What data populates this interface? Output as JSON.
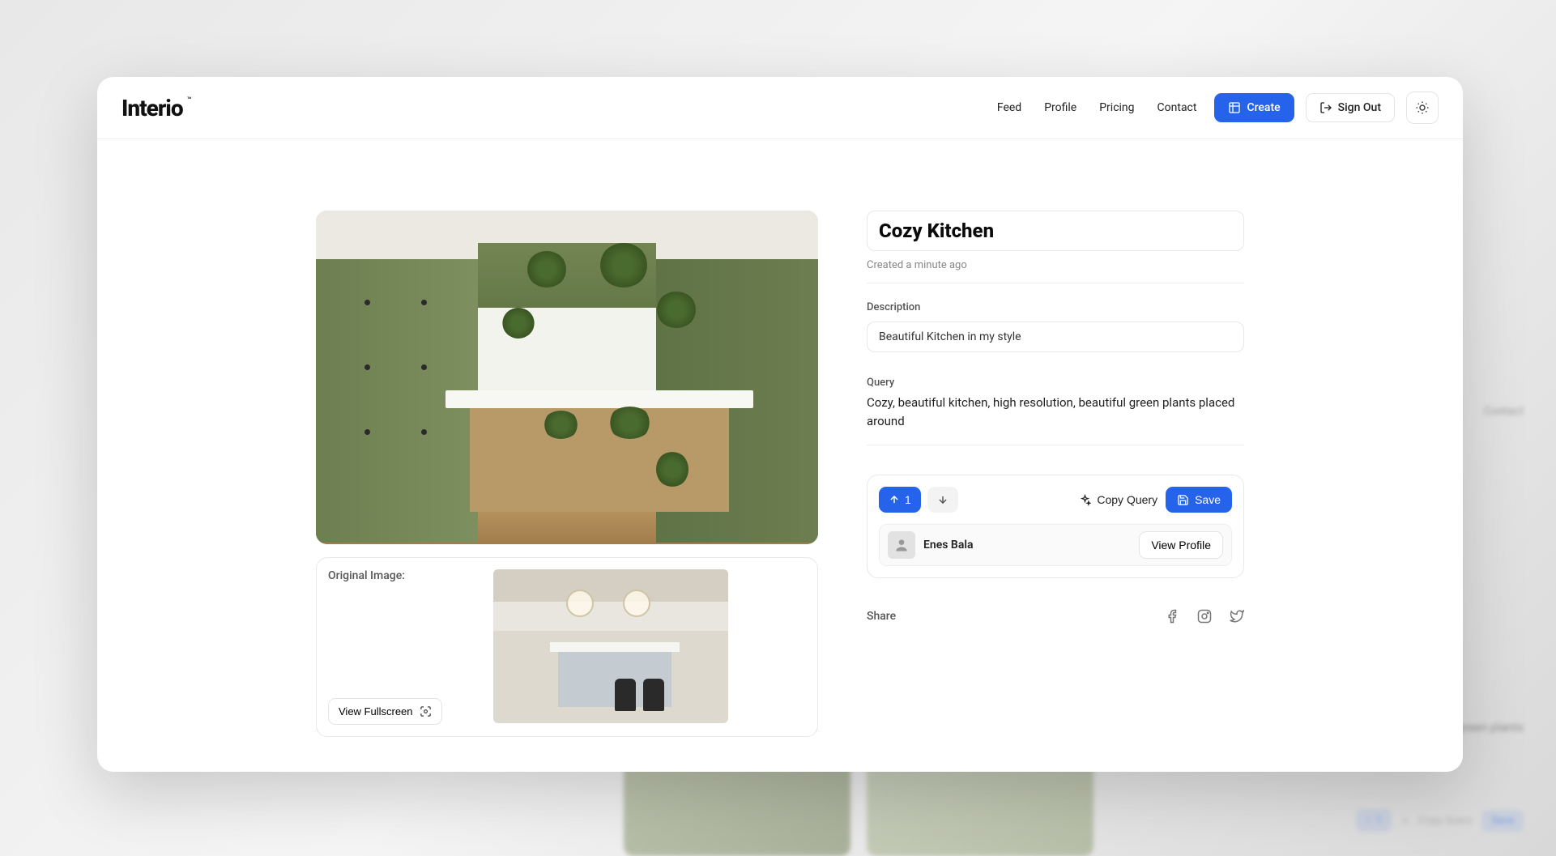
{
  "brand": "Interio",
  "nav": {
    "feed": "Feed",
    "profile": "Profile",
    "pricing": "Pricing",
    "contact": "Contact",
    "create": "Create",
    "signout": "Sign Out"
  },
  "page": {
    "title": "Cozy Kitchen",
    "timestamp": "Created a minute ago",
    "description_label": "Description",
    "description": "Beautiful Kitchen in my style",
    "query_label": "Query",
    "query": "Cozy, beautiful kitchen, high resolution, beautiful green plants placed around",
    "original_label": "Original Image:",
    "view_fullscreen": "View Fullscreen"
  },
  "actions": {
    "upvote_count": "1",
    "copy_query": "Copy Query",
    "save": "Save",
    "view_profile": "View Profile"
  },
  "user": {
    "name": "Enes Bala"
  },
  "share": {
    "label": "Share"
  },
  "bg": {
    "contact": "Contact",
    "query_snippet": "green plants",
    "count": "1",
    "copy": "Copy Query",
    "save": "Save"
  }
}
